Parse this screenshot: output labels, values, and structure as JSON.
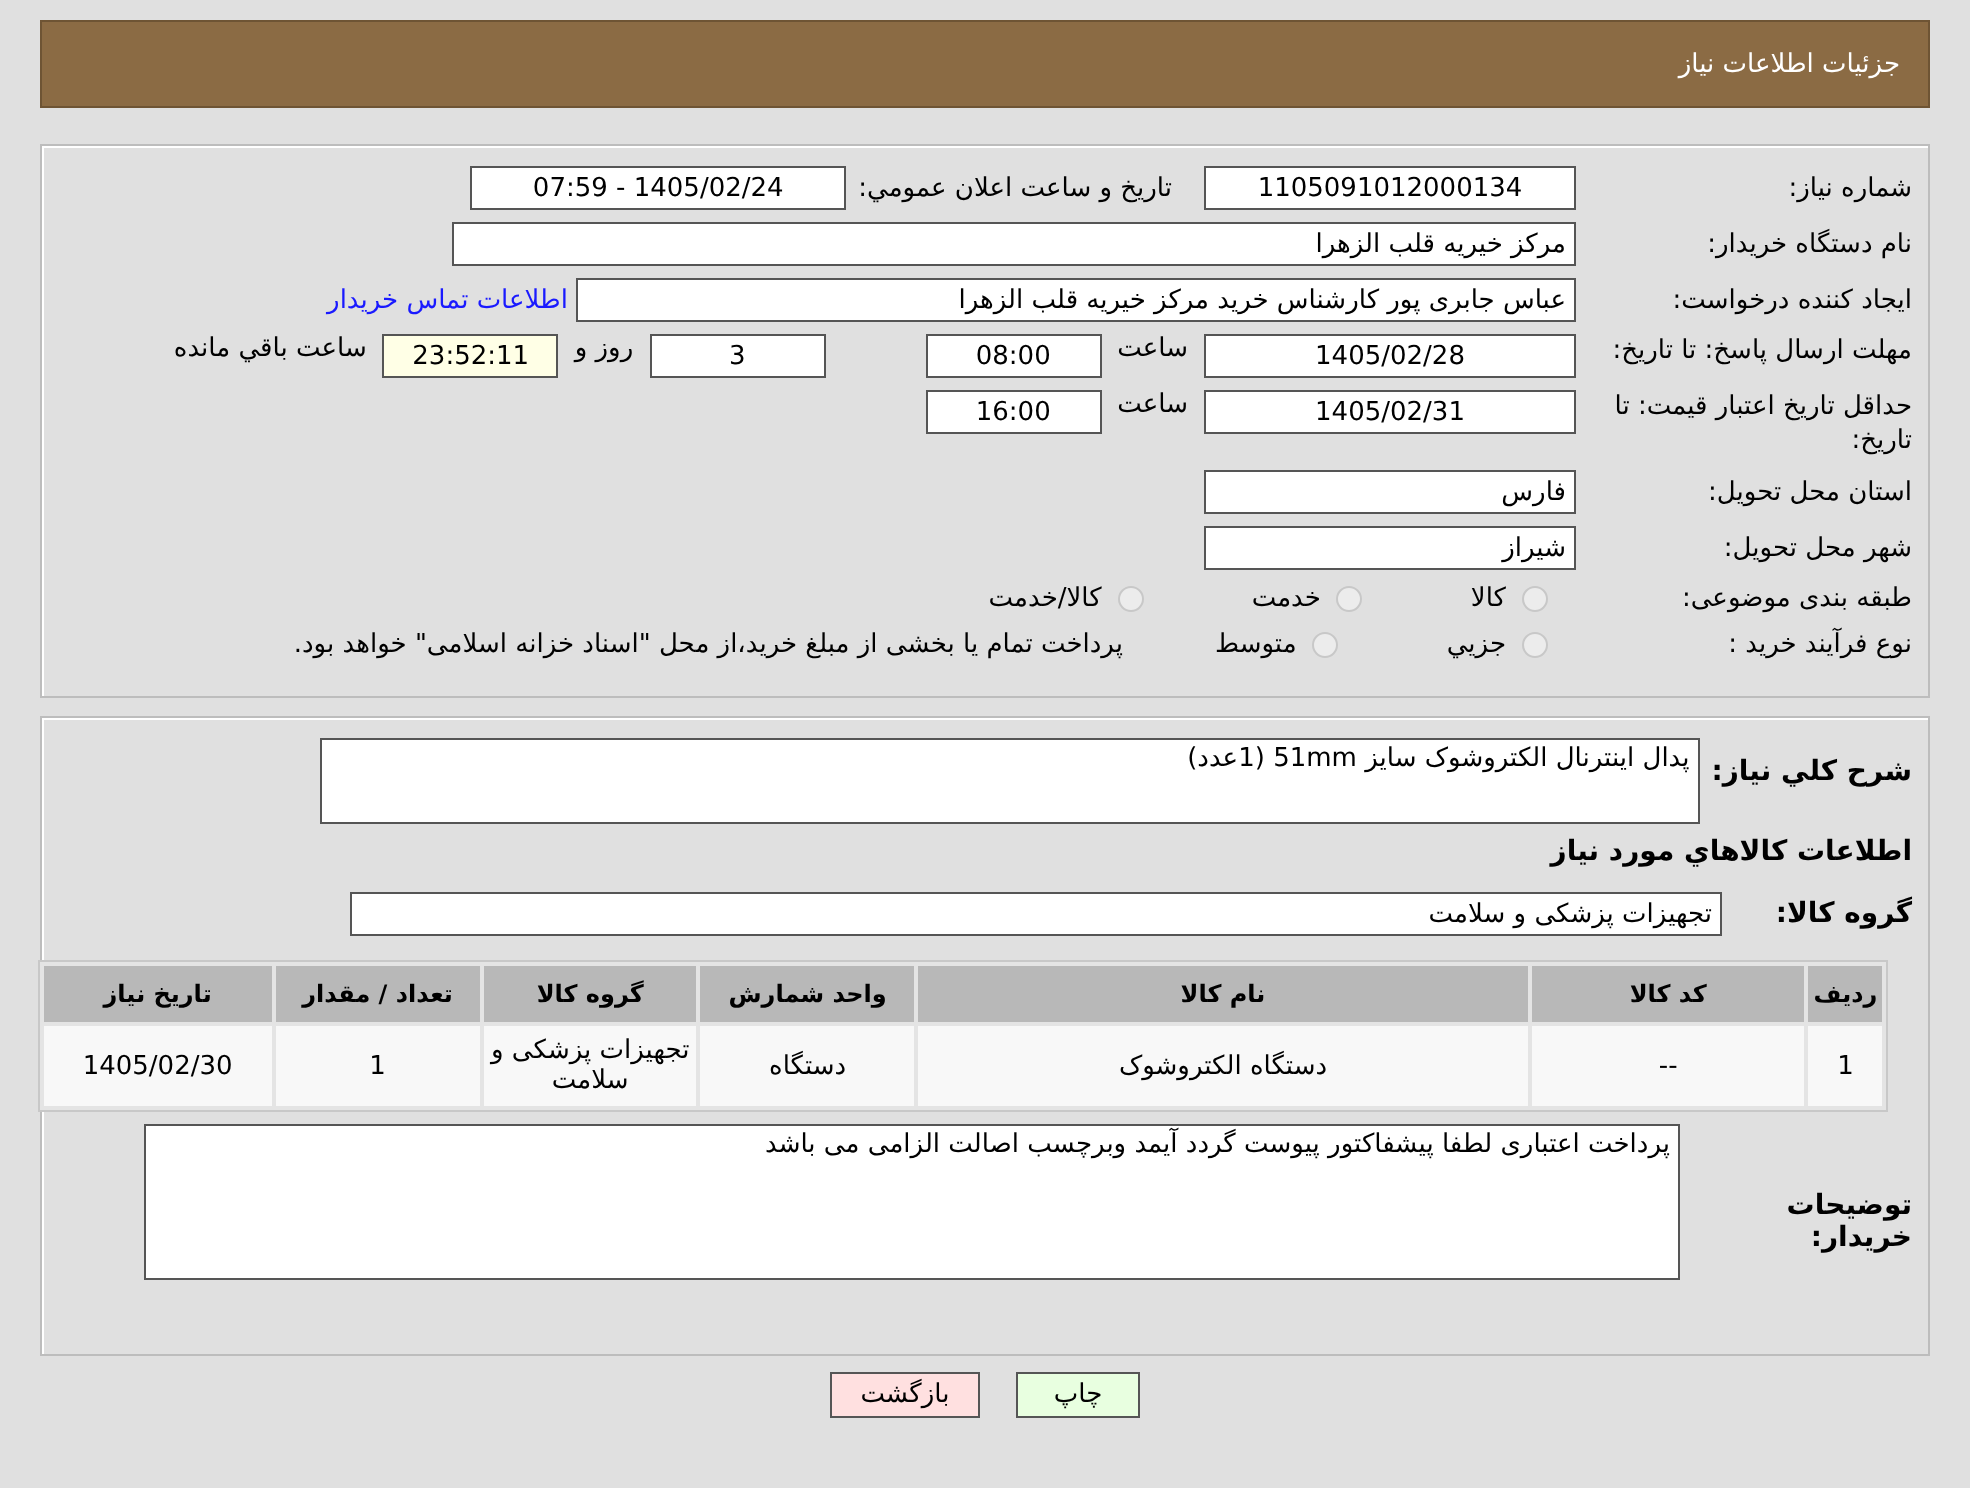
{
  "header": {
    "title": "جزئیات اطلاعات نیاز"
  },
  "need_number": {
    "label": "شماره نیاز:",
    "value": "1105091012000134"
  },
  "announce": {
    "label": "تاریخ و ساعت اعلان عمومي:",
    "value": "1405/02/24 - 07:59"
  },
  "buyer_org": {
    "label": "نام دستگاه خریدار:",
    "value": "مرکز خیریه قلب الزهرا"
  },
  "requester": {
    "label": "ایجاد کننده درخواست:",
    "value": "عباس جابری پور کارشناس خرید مرکز خیریه قلب الزهرا",
    "link": "اطلاعات تماس خریدار"
  },
  "reply_deadline": {
    "label": "مهلت ارسال پاسخ: تا تاریخ:",
    "date": "1405/02/28",
    "time_label": "ساعت",
    "time": "08:00",
    "days": "3",
    "days_label": "روز و",
    "remaining": "23:52:11",
    "remaining_label": "ساعت باقي مانده"
  },
  "price_validity": {
    "label": "حداقل تاریخ اعتبار قیمت: تا تاریخ:",
    "date": "1405/02/31",
    "time_label": "ساعت",
    "time": "16:00"
  },
  "province": {
    "label": "استان محل تحویل:",
    "value": "فارس"
  },
  "city": {
    "label": "شهر محل تحویل:",
    "value": "شیراز"
  },
  "category": {
    "label": "طبقه بندی موضوعی:",
    "options": [
      {
        "label": "کالا",
        "selected": false
      },
      {
        "label": "خدمت",
        "selected": false
      },
      {
        "label": "کالا/خدمت",
        "selected": false
      }
    ]
  },
  "process": {
    "label": "نوع فرآیند خرید :",
    "options": [
      {
        "label": "جزیي",
        "selected": false
      },
      {
        "label": "متوسط",
        "selected": false
      }
    ],
    "note": "پرداخت تمام یا بخشی از مبلغ خرید،از محل \"اسناد خزانه اسلامی\" خواهد بود."
  },
  "description": {
    "label": "شرح کلي نیاز:",
    "value": "پدال اینترنال الکتروشوک سایز 51mm      (1عدد)"
  },
  "goods_heading": "اطلاعات کالاهاي مورد نیاز",
  "goods_group": {
    "label": "گروه کالا:",
    "value": "تجهیزات پزشکی و سلامت"
  },
  "table": {
    "columns": [
      "ردیف",
      "کد کالا",
      "نام کالا",
      "واحد شمارش",
      "گروه کالا",
      "تعداد / مقدار",
      "تاریخ نیاز"
    ],
    "rows": [
      [
        "1",
        "--",
        "دستگاه الکتروشوک",
        "دستگاه",
        "تجهیزات پزشکی و سلامت",
        "1",
        "1405/02/30"
      ]
    ]
  },
  "buyer_notes": {
    "label": "توضیحات خریدار:",
    "value": "پرداخت اعتباری لطفا پیشفاکتور پیوست گردد آیمد وبرچسب اصالت الزامی می باشد"
  },
  "buttons": [
    {
      "label": "چاپ",
      "kind": "print"
    },
    {
      "label": "بازگشت",
      "kind": "back"
    }
  ]
}
